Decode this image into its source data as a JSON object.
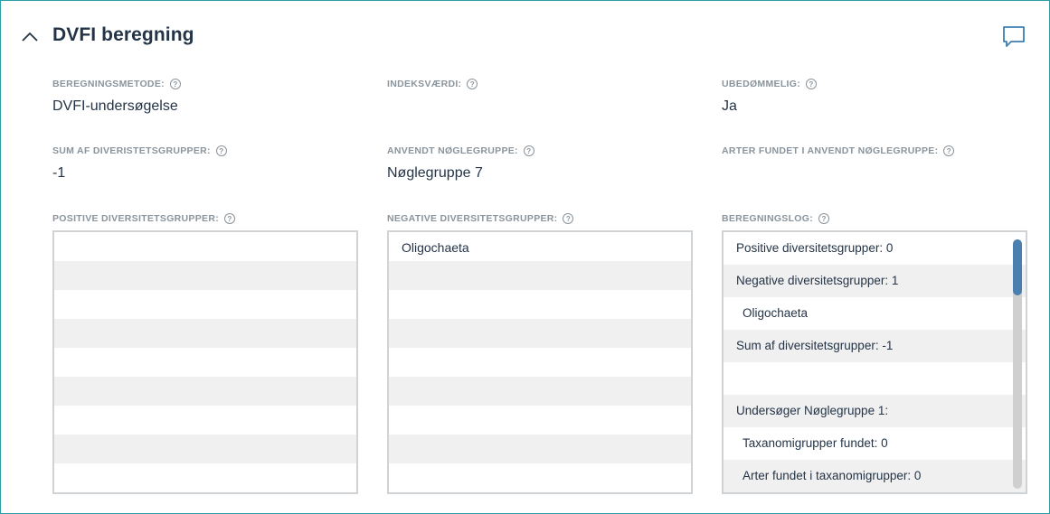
{
  "header": {
    "title": "DVFI beregning",
    "collapse_icon": "chevron-up-icon",
    "comment_icon": "comment-icon"
  },
  "fields": {
    "method": {
      "label": "BEREGNINGSMETODE:",
      "value": "DVFI-undersøgelse"
    },
    "index": {
      "label": "INDEKSVÆRDI:",
      "value": ""
    },
    "unassessable": {
      "label": "UBEDØMMELIG:",
      "value": "Ja"
    },
    "sum_diversity": {
      "label": "SUM AF DIVERISTETSGRUPPER:",
      "value": "-1"
    },
    "key_group": {
      "label": "ANVENDT NØGLEGRUPPE:",
      "value": "Nøglegruppe 7"
    },
    "species_found": {
      "label": "ARTER FUNDET I ANVENDT NØGLEGRUPPE:",
      "value": ""
    }
  },
  "help_glyph": "?",
  "lists": {
    "positive": {
      "label": "POSITIVE DIVERSITETSGRUPPER:",
      "rows": [
        "",
        "",
        "",
        "",
        "",
        "",
        "",
        "",
        ""
      ]
    },
    "negative": {
      "label": "NEGATIVE DIVERSITETSGRUPPER:",
      "rows": [
        "Oligochaeta",
        "",
        "",
        "",
        "",
        "",
        "",
        "",
        ""
      ]
    },
    "log": {
      "label": "BEREGNINGSLOG:",
      "rows": [
        "Positive diversitetsgrupper: 0",
        "Negative diversitetsgrupper: 1",
        "Oligochaeta",
        "Sum af diversitetsgrupper: -1",
        "",
        "Undersøger Nøglegruppe 1:",
        "Taxanomigrupper fundet: 0",
        "Arter fundet i taxanomigrupper: 0"
      ]
    }
  },
  "colors": {
    "border": "#2a9da6",
    "scroll_thumb": "#4a7fb0"
  }
}
